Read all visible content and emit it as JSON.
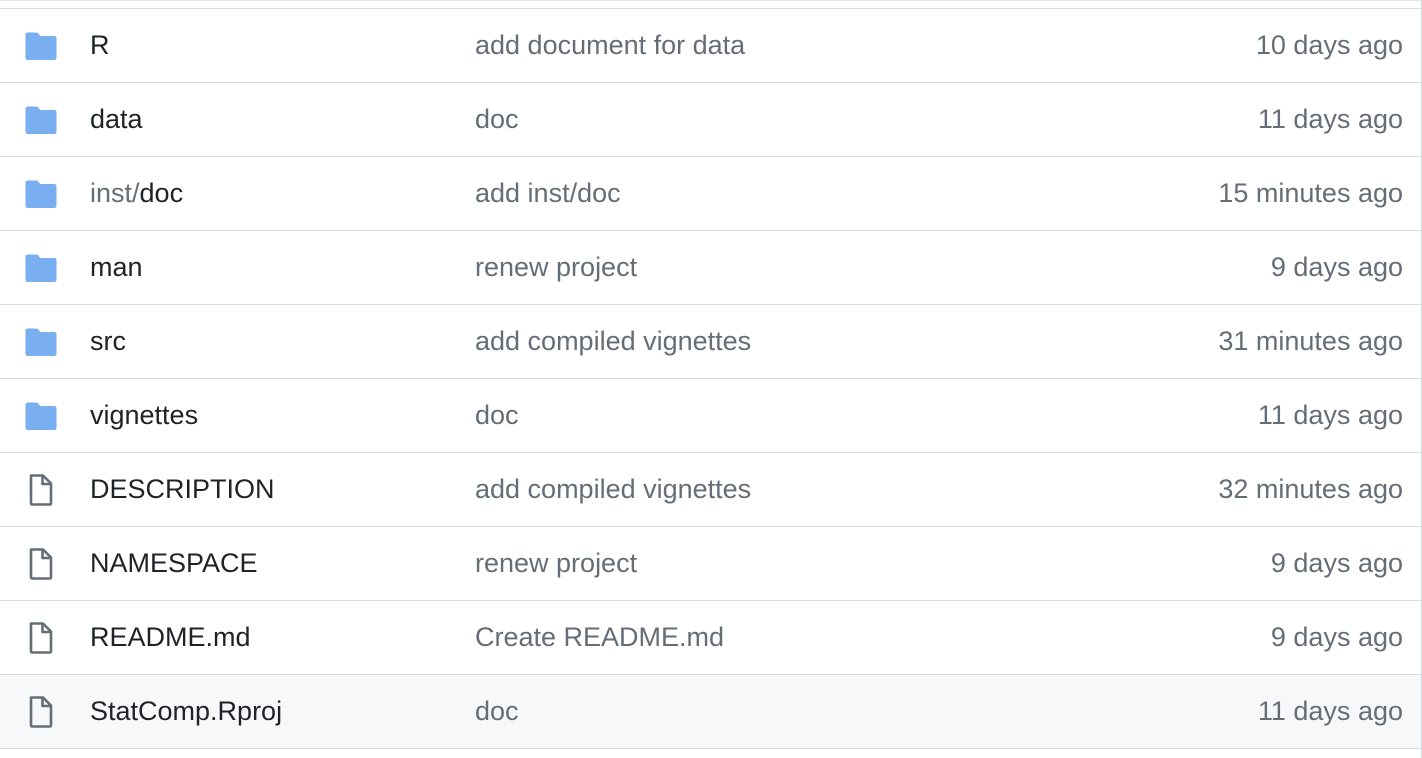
{
  "colors": {
    "folder_icon": "#79aef0",
    "file_icon": "#656d76",
    "name_text": "#1f2328",
    "muted_text": "#656d76",
    "border": "#d8dee4",
    "hover_row_bg": "#f6f8fa"
  },
  "rows": [
    {
      "type": "folder",
      "icon": "folder-icon",
      "name_prefix": "",
      "name": "R",
      "message": "add document for data",
      "age": "10 days ago"
    },
    {
      "type": "folder",
      "icon": "folder-icon",
      "name_prefix": "",
      "name": "data",
      "message": "doc",
      "age": "11 days ago"
    },
    {
      "type": "folder",
      "icon": "folder-icon",
      "name_prefix": "inst/",
      "name": "doc",
      "message": "add inst/doc",
      "age": "15 minutes ago"
    },
    {
      "type": "folder",
      "icon": "folder-icon",
      "name_prefix": "",
      "name": "man",
      "message": "renew project",
      "age": "9 days ago"
    },
    {
      "type": "folder",
      "icon": "folder-icon",
      "name_prefix": "",
      "name": "src",
      "message": "add compiled vignettes",
      "age": "31 minutes ago"
    },
    {
      "type": "folder",
      "icon": "folder-icon",
      "name_prefix": "",
      "name": "vignettes",
      "message": "doc",
      "age": "11 days ago"
    },
    {
      "type": "file",
      "icon": "file-icon",
      "name_prefix": "",
      "name": "DESCRIPTION",
      "message": "add compiled vignettes",
      "age": "32 minutes ago"
    },
    {
      "type": "file",
      "icon": "file-icon",
      "name_prefix": "",
      "name": "NAMESPACE",
      "message": "renew project",
      "age": "9 days ago"
    },
    {
      "type": "file",
      "icon": "file-icon",
      "name_prefix": "",
      "name": "README.md",
      "message": "Create README.md",
      "age": "9 days ago"
    },
    {
      "type": "file",
      "icon": "file-icon",
      "name_prefix": "",
      "name": "StatComp.Rproj",
      "message": "doc",
      "age": "11 days ago",
      "hovered": true
    }
  ]
}
